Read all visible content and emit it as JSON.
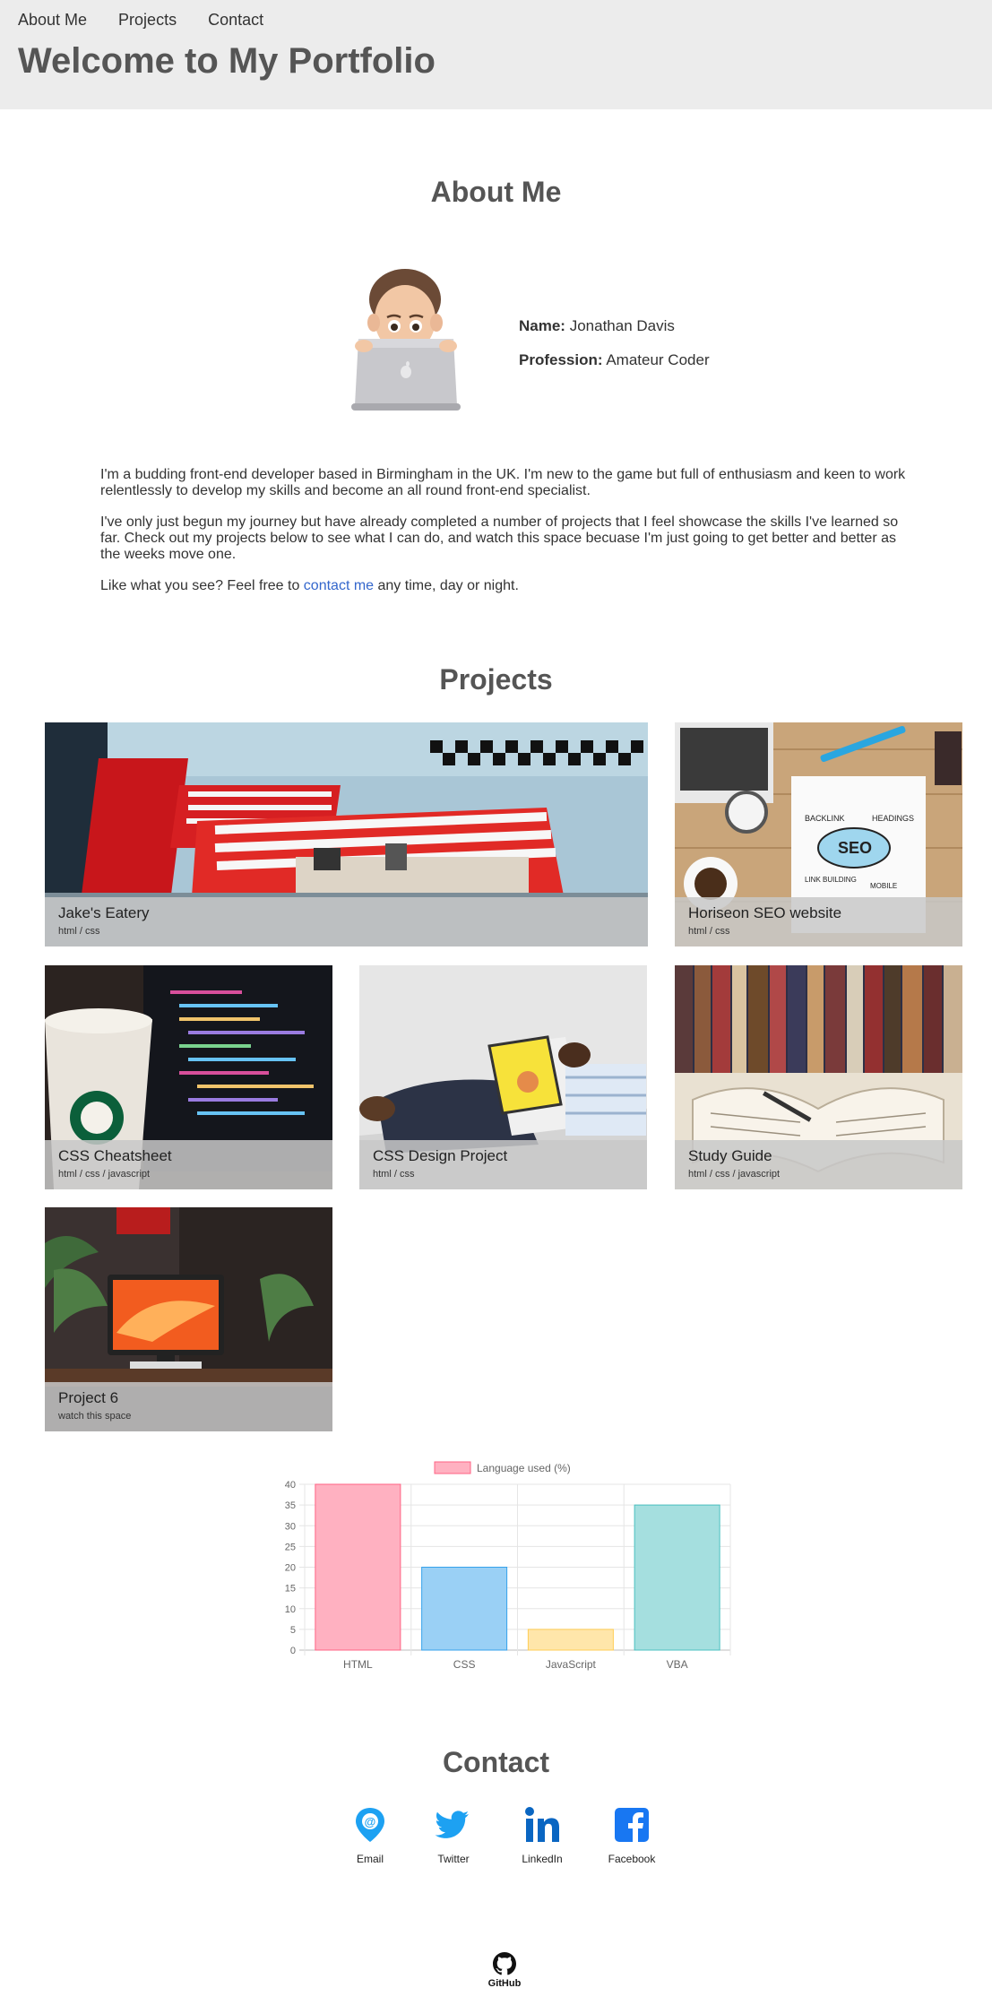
{
  "nav": {
    "items": [
      "About Me",
      "Projects",
      "Contact"
    ]
  },
  "header": {
    "title": "Welcome to My Portfolio"
  },
  "about": {
    "heading": "About Me",
    "name_label": "Name:",
    "name": "Jonathan Davis",
    "profession_label": "Profession:",
    "profession": "Amateur Coder",
    "bio_1": "I'm a budding front-end developer based in Birmingham in the UK. I'm new to the game but full of enthusiasm and keen to work relentlessly to develop my skills and become an all round front-end specialist.",
    "bio_2": "I've only just begun my journey but have already completed a number of projects that I feel showcase the skills I've learned so far. Check out my projects below to see what I can do, and watch this space becuase I'm just going to get better and better as the weeks move one.",
    "bio_3_pre": "Like what you see? Feel free to ",
    "bio_3_link": "contact me",
    "bio_3_post": " any time, day or night."
  },
  "projects": {
    "heading": "Projects",
    "items": [
      {
        "title": "Jake's Eatery",
        "tags": "html / css"
      },
      {
        "title": "Horiseon SEO website",
        "tags": "html / css"
      },
      {
        "title": "CSS Cheatsheet",
        "tags": "html / css / javascript"
      },
      {
        "title": "CSS Design Project",
        "tags": "html / css"
      },
      {
        "title": "Study Guide",
        "tags": "html / css / javascript"
      },
      {
        "title": "Project 6",
        "tags": "watch this space"
      }
    ]
  },
  "chart_data": {
    "type": "bar",
    "categories": [
      "HTML",
      "CSS",
      "JavaScript",
      "VBA"
    ],
    "series": [
      {
        "name": "Language used (%)",
        "values": [
          40,
          20,
          5,
          35
        ]
      }
    ],
    "ylim": [
      0,
      40
    ],
    "yticks": [
      0,
      5,
      10,
      15,
      20,
      25,
      30,
      35,
      40
    ],
    "colors": {
      "fill": [
        "#ffb1c1",
        "#9ad0f5",
        "#ffe6aa",
        "#a5dfdf"
      ],
      "stroke": [
        "#ff6384",
        "#36a2eb",
        "#ffcd56",
        "#4bc0c0"
      ]
    },
    "legend": "top",
    "grid": true
  },
  "contact": {
    "heading": "Contact",
    "items": [
      {
        "label": "Email",
        "icon": "email-pin-icon"
      },
      {
        "label": "Twitter",
        "icon": "twitter-icon"
      },
      {
        "label": "LinkedIn",
        "icon": "linkedin-icon"
      },
      {
        "label": "Facebook",
        "icon": "facebook-icon"
      }
    ]
  },
  "footer": {
    "github_label": "GitHub"
  },
  "colors": {
    "header_bg": "#ececec",
    "heading": "#555555",
    "link": "#3366cc",
    "social_blue": "#1da1f2",
    "linkedin_blue": "#0a66c2",
    "facebook_blue": "#1877f2"
  }
}
